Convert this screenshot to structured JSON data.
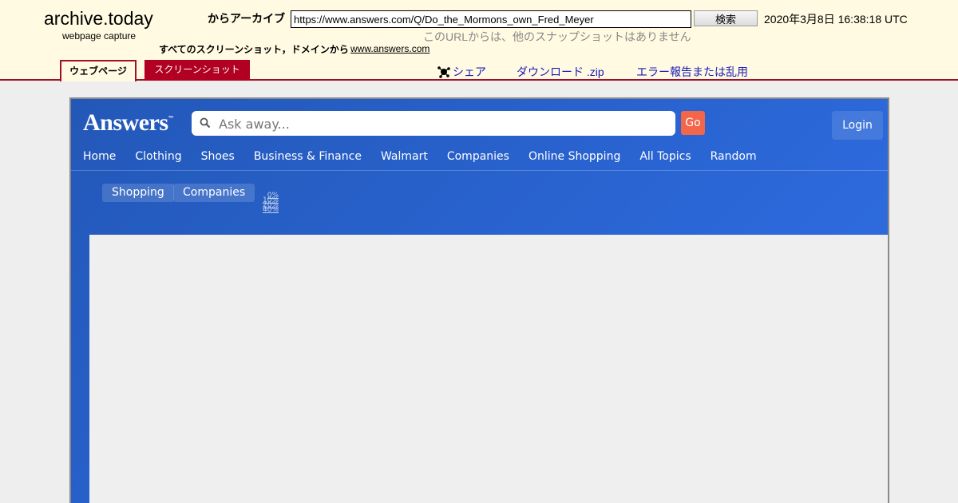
{
  "archive": {
    "logo": "archive.today",
    "subtitle": "webpage capture",
    "from_label": "からアーカイブ",
    "url_value": "https://www.answers.com/Q/Do_the_Mormons_own_Fred_Meyer",
    "search_button": "検索",
    "datetime": "2020年3月8日 16:38:18 UTC",
    "no_snapshots": "このURLからは、他のスナップショットはありません",
    "all_screenshots": "すべてのスクリーンショット，ドメインから",
    "domain_link": "www.answers.com",
    "tabs": {
      "webpage": "ウェブページ",
      "screenshot": "スクリーンショット"
    },
    "links": {
      "share": "シェア",
      "download": "ダウンロード .zip",
      "report": "エラー報告または乱用"
    },
    "colors": {
      "header_bg": "#fffae1",
      "accent_red": "#a0102a",
      "link_blue": "#1a1ab8"
    }
  },
  "answers": {
    "logo": "Answers",
    "logo_tm": "™",
    "search_placeholder": "Ask away...",
    "go_button": "Go",
    "login_button": "Login",
    "nav": [
      "Home",
      "Clothing",
      "Shoes",
      "Business & Finance",
      "Walmart",
      "Companies",
      "Online Shopping",
      "All Topics",
      "Random"
    ],
    "chips": {
      "shopping": "Shopping",
      "companies": "Companies"
    },
    "progress_labels": [
      "0%",
      "10%",
      "20%",
      "40%"
    ],
    "colors": {
      "header_blue": "#2b66d6",
      "go_orange": "#f4664a"
    }
  }
}
